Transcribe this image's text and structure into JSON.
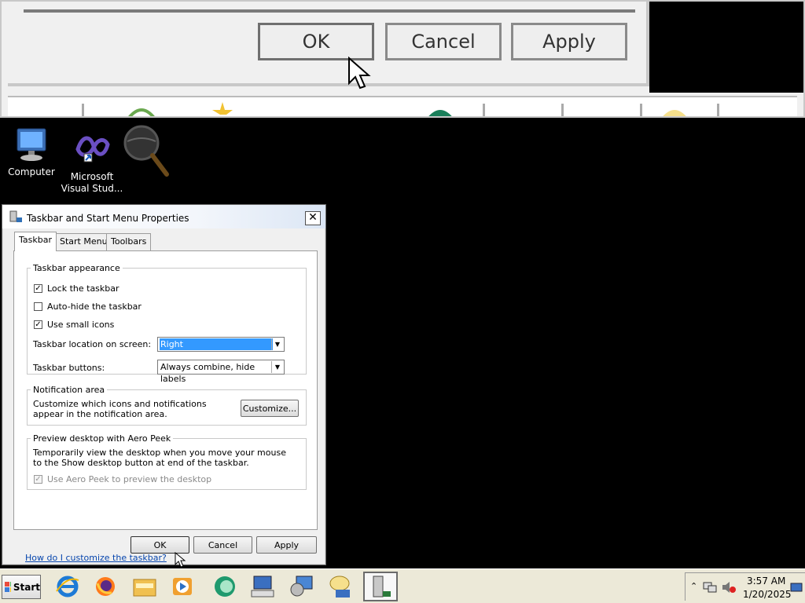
{
  "magnifier": {
    "ok_label": "OK",
    "cancel_label": "Cancel",
    "apply_label": "Apply"
  },
  "desktop": {
    "icons": [
      {
        "label": "Computer",
        "icon": "computer-icon"
      },
      {
        "label": "Microsoft Visual Stud...",
        "icon": "visual-studio-icon"
      }
    ]
  },
  "dialog": {
    "title": "Taskbar and Start Menu Properties",
    "tabs": [
      "Taskbar",
      "Start Menu",
      "Toolbars"
    ],
    "active_tab": "Taskbar",
    "appearance": {
      "legend": "Taskbar appearance",
      "lock_taskbar": {
        "label": "Lock the taskbar",
        "checked": true
      },
      "auto_hide": {
        "label": "Auto-hide the taskbar",
        "checked": false
      },
      "small_icons": {
        "label": "Use small icons",
        "checked": true
      },
      "location_label": "Taskbar location on screen:",
      "location_value": "Right",
      "buttons_label": "Taskbar buttons:",
      "buttons_value": "Always combine, hide labels"
    },
    "notification": {
      "legend": "Notification area",
      "description": "Customize which icons and notifications appear in the notification area.",
      "customize_label": "Customize..."
    },
    "peek": {
      "legend": "Preview desktop with Aero Peek",
      "description": "Temporarily view the desktop when you move your mouse to the Show desktop button at end of the taskbar.",
      "checkbox_label": "Use Aero Peek to preview the desktop",
      "checked": true,
      "enabled": false
    },
    "help_link": "How do I customize the taskbar?",
    "ok_label": "OK",
    "cancel_label": "Cancel",
    "apply_label": "Apply"
  },
  "taskbar": {
    "start_label": "Start",
    "items": [
      "internet-explorer-icon",
      "firefox-icon",
      "explorer-folder-icon",
      "media-player-icon",
      "chat-icon",
      "keyboard-computer-icon",
      "network-computer-icon",
      "messaging-icon",
      "taskbar-properties-icon"
    ],
    "clock_time": "3:57 AM",
    "clock_date": "1/20/2025"
  },
  "colors": {
    "selection": "#3399ff",
    "link": "#0645ad",
    "desktop": "#000000"
  }
}
